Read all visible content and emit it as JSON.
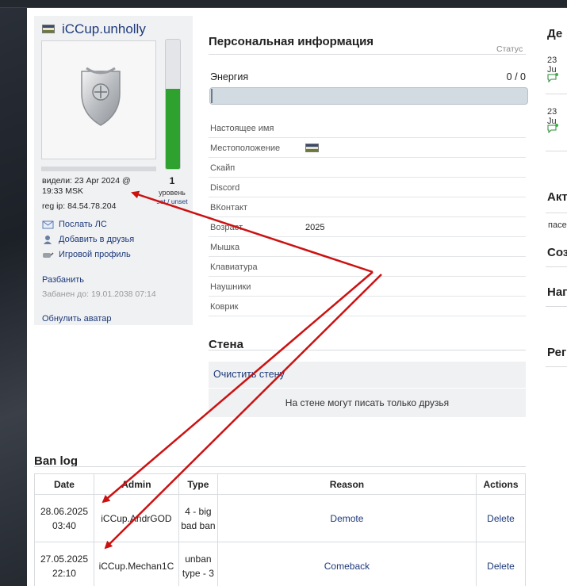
{
  "profile": {
    "username": "iCCup.unholly",
    "level": "1",
    "level_label": "уровень",
    "level_links": "set / unset",
    "energy_fill_fraction": 0.62,
    "last_seen": "видели: 23 Apr 2024 @ 19:33 MSK",
    "reg_ip": "reg ip: 84.54.78.204",
    "actions": [
      {
        "label": "Послать ЛС",
        "icon": "mail-icon"
      },
      {
        "label": "Добавить в друзья",
        "icon": "add-friend-icon"
      },
      {
        "label": "Игровой профиль",
        "icon": "game-profile-icon"
      }
    ],
    "unban_label": "Разбанить",
    "banned_until": "Забанен до: 19.01.2038 07:14",
    "reset_avatar_label": "Обнулить аватар"
  },
  "personal_info": {
    "title": "Персональная информация",
    "status_label": "Статус",
    "energy_label": "Энергия",
    "energy_value": "0 / 0",
    "energy_fill_fraction": 0.0,
    "fields": [
      {
        "key": "Настоящее имя",
        "value": ""
      },
      {
        "key": "Местоположение",
        "value": "",
        "flag": true
      },
      {
        "key": "Скайп",
        "value": ""
      },
      {
        "key": "Discord",
        "value": ""
      },
      {
        "key": "ВКонтакт",
        "value": ""
      },
      {
        "key": "Возраст",
        "value": "2025"
      },
      {
        "key": "Мышка",
        "value": ""
      },
      {
        "key": "Клавиатура",
        "value": ""
      },
      {
        "key": "Наушники",
        "value": ""
      },
      {
        "key": "Коврик",
        "value": ""
      }
    ]
  },
  "wall": {
    "title": "Стена",
    "clear_label": "Очистить стену",
    "note": "На стене могут писать только друзья"
  },
  "ban_log": {
    "title": "Ban log",
    "headers": [
      "Date",
      "Admin",
      "Type",
      "Reason",
      "Actions"
    ],
    "rows": [
      {
        "date": "28.06.2025 03:40",
        "admin": "iCCup.AndrGOD",
        "type": "4 - big bad ban",
        "reason": "Demote",
        "action": "Delete"
      },
      {
        "date": "27.05.2025 22:10",
        "admin": "iCCup.Mechan1C",
        "type": "unban type - 3",
        "reason": "Comeback",
        "action": "Delete"
      }
    ]
  },
  "right_column": {
    "head1": "Де",
    "date1": "23 Ju",
    "date2": "23 Ju",
    "head2": "Акт",
    "text2": "пасе",
    "head3": "Соз",
    "head4": "Наг",
    "head5": "Рег"
  },
  "colors": {
    "link": "#1d3a7a",
    "energy_green": "#2fa12f",
    "arrow_red": "#cc1111"
  }
}
